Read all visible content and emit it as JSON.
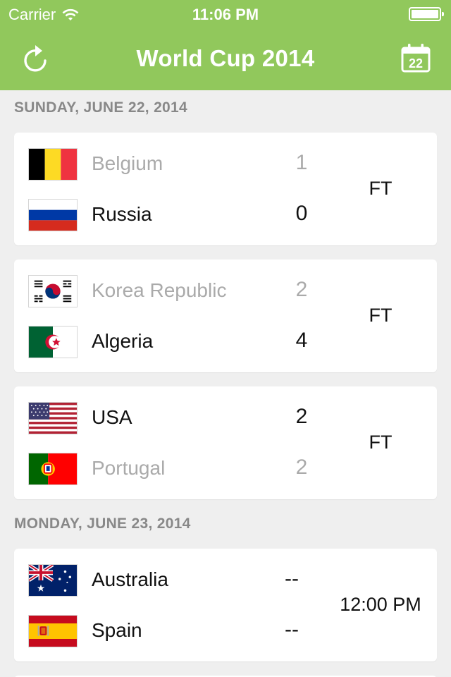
{
  "status": {
    "carrier": "Carrier",
    "time": "11:06 PM"
  },
  "header": {
    "title": "World Cup 2014",
    "calendar_day": "22"
  },
  "sections": [
    {
      "label": "SUNDAY, JUNE 22, 2014",
      "matches": [
        {
          "state": "FT",
          "home": {
            "team": "Belgium",
            "score": "1",
            "flag": "belgium"
          },
          "away": {
            "team": "Russia",
            "score": "0",
            "flag": "russia"
          }
        },
        {
          "state": "FT",
          "home": {
            "team": "Korea Republic",
            "score": "2",
            "flag": "korea"
          },
          "away": {
            "team": "Algeria",
            "score": "4",
            "flag": "algeria"
          }
        },
        {
          "state": "FT",
          "home": {
            "team": "USA",
            "score": "2",
            "flag": "usa"
          },
          "away": {
            "team": "Portugal",
            "score": "2",
            "flag": "portugal"
          }
        }
      ]
    },
    {
      "label": "MONDAY, JUNE 23, 2014",
      "matches": [
        {
          "state": "12:00 PM",
          "home": {
            "team": "Australia",
            "score": "--",
            "flag": "australia"
          },
          "away": {
            "team": "Spain",
            "score": "--",
            "flag": "spain"
          }
        }
      ]
    }
  ],
  "colors": {
    "header": "#91c85c",
    "muted_text": "#aaaaaa",
    "section_text": "#888888"
  }
}
